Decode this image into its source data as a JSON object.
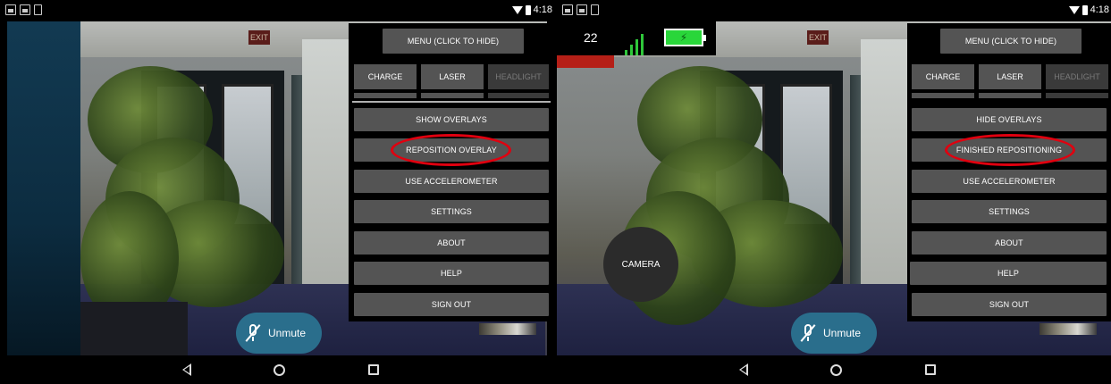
{
  "status_bar": {
    "time": "4:18"
  },
  "left_screen": {
    "menu_toggle_label": "MENU (CLICK TO HIDE)",
    "tabs": [
      {
        "label": "CHARGE",
        "enabled": true
      },
      {
        "label": "LASER",
        "enabled": true
      },
      {
        "label": "HEADLIGHT",
        "enabled": false
      }
    ],
    "menu_items": [
      {
        "label": "SHOW OVERLAYS",
        "highlighted": false
      },
      {
        "label": "REPOSITION OVERLAY",
        "highlighted": true
      },
      {
        "label": "USE ACCELEROMETER",
        "highlighted": false
      },
      {
        "label": "SETTINGS",
        "highlighted": false
      },
      {
        "label": "ABOUT",
        "highlighted": false
      },
      {
        "label": "HELP",
        "highlighted": false
      },
      {
        "label": "SIGN OUT",
        "highlighted": false
      }
    ],
    "unmute_label": "Unmute",
    "scene_sign": "EXIT"
  },
  "right_screen": {
    "menu_toggle_label": "MENU (CLICK TO HIDE)",
    "tabs": [
      {
        "label": "CHARGE",
        "enabled": true
      },
      {
        "label": "LASER",
        "enabled": true
      },
      {
        "label": "HEADLIGHT",
        "enabled": false
      }
    ],
    "menu_items": [
      {
        "label": "HIDE OVERLAYS",
        "highlighted": false
      },
      {
        "label": "FINISHED REPOSITIONING",
        "highlighted": true
      },
      {
        "label": "USE ACCELEROMETER",
        "highlighted": false
      },
      {
        "label": "SETTINGS",
        "highlighted": false
      },
      {
        "label": "ABOUT",
        "highlighted": false
      },
      {
        "label": "HELP",
        "highlighted": false
      },
      {
        "label": "SIGN OUT",
        "highlighted": false
      }
    ],
    "unmute_label": "Unmute",
    "camera_button_label": "CAMERA",
    "hud": {
      "counter": "22",
      "battery_charging": true
    },
    "scene_sign": "EXIT"
  },
  "colors": {
    "button_bg": "#545454",
    "highlight_ring": "#e0000f",
    "unmute_bg": "#2a6e8c",
    "battery_green": "#29d63a",
    "signal_green": "#2fc73a",
    "alert_red": "#b51f17"
  }
}
